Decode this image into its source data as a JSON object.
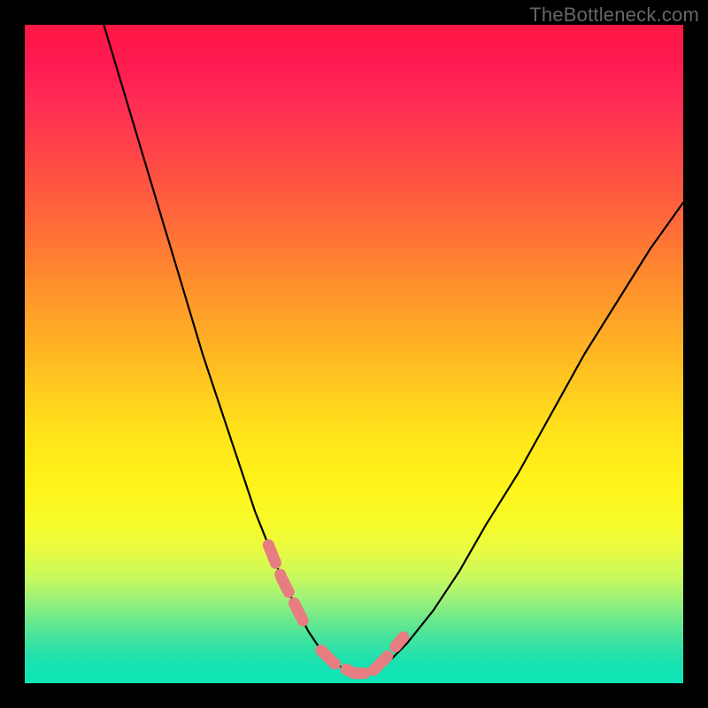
{
  "watermark": "TheBottleneck.com",
  "colors": {
    "curve": "#000000",
    "accent": "#e77d80",
    "gradient_top": "#ff1744",
    "gradient_bottom": "#0be5b7"
  },
  "chart_data": {
    "type": "line",
    "title": "",
    "xlabel": "",
    "ylabel": "",
    "xlim": [
      0,
      100
    ],
    "ylim": [
      0,
      100
    ],
    "series": [
      {
        "name": "bottleneck-curve",
        "x": [
          12,
          15,
          18,
          21,
          24,
          27,
          30,
          33,
          35,
          37,
          39,
          41,
          43,
          45,
          47,
          50,
          52,
          55,
          58,
          62,
          66,
          70,
          75,
          80,
          85,
          90,
          95,
          100
        ],
        "y": [
          100,
          90,
          80,
          70,
          60,
          50,
          41,
          32,
          26,
          21,
          16,
          12,
          8,
          5,
          3,
          1.5,
          1.5,
          3,
          6,
          11,
          17,
          24,
          32,
          41,
          50,
          58,
          66,
          73
        ]
      }
    ],
    "accent_segments": [
      {
        "name": "left-dash",
        "x": [
          37,
          39,
          41,
          43
        ],
        "y": [
          21,
          16,
          12,
          8
        ]
      },
      {
        "name": "bottom-dash",
        "x": [
          45,
          47,
          50,
          52
        ],
        "y": [
          5,
          3,
          1.5,
          1.5
        ]
      },
      {
        "name": "right-dash",
        "x": [
          53,
          55,
          57.5
        ],
        "y": [
          2,
          4,
          7
        ]
      }
    ]
  }
}
